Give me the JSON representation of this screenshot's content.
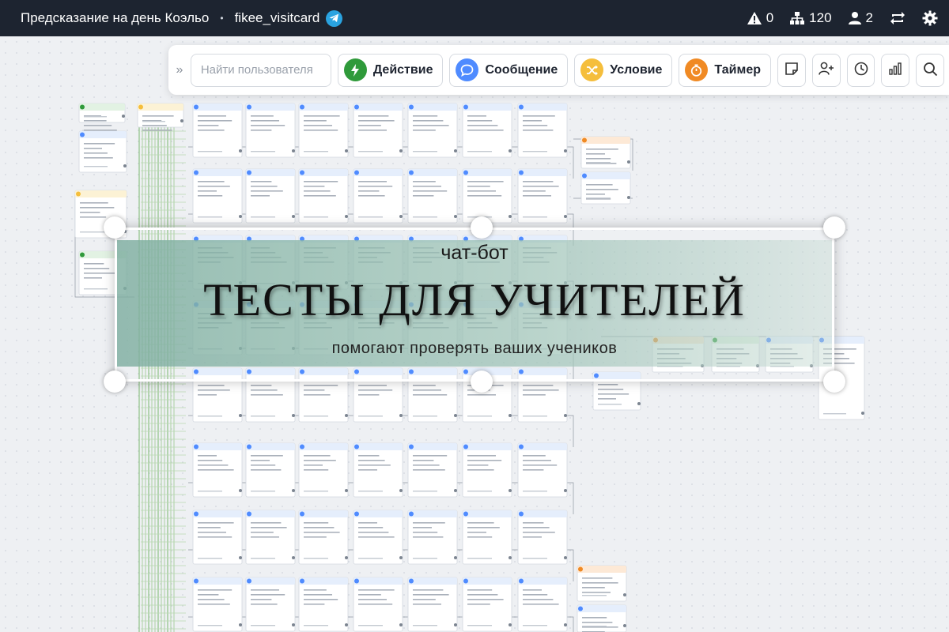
{
  "header": {
    "title": "Предсказание на день Коэльо",
    "separator": "•",
    "bot_name": "fikee_visitcard",
    "warnings": "0",
    "subscribers": "120",
    "users": "2"
  },
  "toolbar": {
    "collapse": "»",
    "search_placeholder": "Найти пользователя",
    "action_label": "Действие",
    "message_label": "Сообщение",
    "condition_label": "Условие",
    "timer_label": "Таймер"
  },
  "banner": {
    "subtitle_top": "чат-бот",
    "headline": "ТЕСТЫ ДЛЯ УЧИТЕЛЕЙ",
    "subtitle_bottom": "помогают проверять ваших учеников"
  },
  "colors": {
    "header_bg": "#1d2430",
    "telegram": "#2aa3e0",
    "action": "#2f9a3a",
    "message": "#4f8bff",
    "condition": "#f5be3c",
    "timer": "#f08a24",
    "banner_fill": "#7eaea0"
  }
}
